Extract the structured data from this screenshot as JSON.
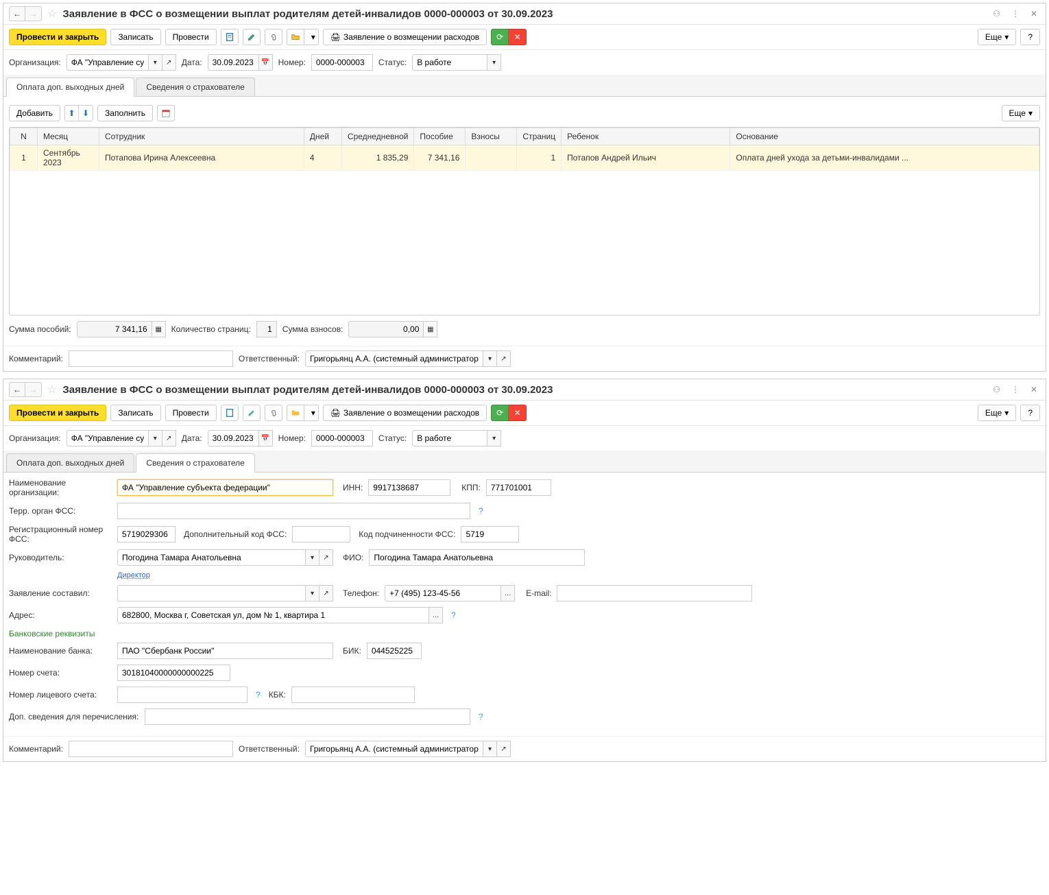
{
  "title": "Заявление в ФСС о возмещении выплат родителям детей-инвалидов 0000-000003 от 30.09.2023",
  "toolbar": {
    "post_close": "Провести и закрыть",
    "save": "Записать",
    "post": "Провести",
    "statement": "Заявление о возмещении расходов",
    "more": "Еще",
    "help": "?"
  },
  "header": {
    "org_label": "Организация:",
    "org_value": "ФА \"Управление субъекта",
    "date_label": "Дата:",
    "date_value": "30.09.2023",
    "num_label": "Номер:",
    "num_value": "0000-000003",
    "status_label": "Статус:",
    "status_value": "В работе"
  },
  "tabs": {
    "t1": "Оплата доп. выходных дней",
    "t2": "Сведения о страхователе"
  },
  "subtoolbar": {
    "add": "Добавить",
    "fill": "Заполнить"
  },
  "table": {
    "cols": {
      "n": "N",
      "month": "Месяц",
      "emp": "Сотрудник",
      "days": "Дней",
      "avg": "Среднедневной",
      "benefit": "Пособие",
      "contrib": "Взносы",
      "pages": "Страниц",
      "child": "Ребенок",
      "basis": "Основание"
    },
    "rows": [
      {
        "n": "1",
        "month": "Сентябрь 2023",
        "emp": "Потапова Ирина Алексеевна",
        "days": "4",
        "avg": "1 835,29",
        "benefit": "7 341,16",
        "contrib": "",
        "pages": "1",
        "child": "Потапов Андрей Ильич",
        "basis": "Оплата дней ухода за детьми-инвалидами ..."
      }
    ]
  },
  "totals": {
    "sum_label": "Сумма пособий:",
    "sum_value": "7 341,16",
    "pages_label": "Количество страниц:",
    "pages_value": "1",
    "contrib_label": "Сумма взносов:",
    "contrib_value": "0,00"
  },
  "footer": {
    "comment_label": "Комментарий:",
    "resp_label": "Ответственный:",
    "resp_value": "Григорьянц А.А. (системный администратор)"
  },
  "insurer": {
    "org_name_label": "Наименование организации:",
    "org_name": "ФА \"Управление субъекта федерации\"",
    "inn_label": "ИНН:",
    "inn": "9917138687",
    "kpp_label": "КПП:",
    "kpp": "771701001",
    "terr_label": "Терр. орган ФСС:",
    "reg_label": "Регистрационный номер ФСС:",
    "reg": "5719029306",
    "addcode_label": "Дополнительный код ФСС:",
    "subcode_label": "Код подчиненности ФСС:",
    "subcode": "5719",
    "head_label": "Руководитель:",
    "head": "Погодина Тамара Анатольевна",
    "fio_label": "ФИО:",
    "fio": "Погодина Тамара Анатольевна",
    "director_link": "Директор",
    "compiled_label": "Заявление составил:",
    "phone_label": "Телефон:",
    "phone": "+7 (495) 123-45-56",
    "email_label": "E-mail:",
    "addr_label": "Адрес:",
    "addr": "682800, Москва г, Советская ул, дом № 1, квартира 1",
    "bank_section": "Банковские реквизиты",
    "bank_label": "Наименование банка:",
    "bank": "ПАО \"Сбербанк России\"",
    "bik_label": "БИК:",
    "bik": "044525225",
    "acc_label": "Номер счета:",
    "acc": "30181040000000000225",
    "pers_label": "Номер лицевого счета:",
    "kbk_label": "КБК:",
    "extra_label": "Доп. сведения для перечисления:"
  }
}
